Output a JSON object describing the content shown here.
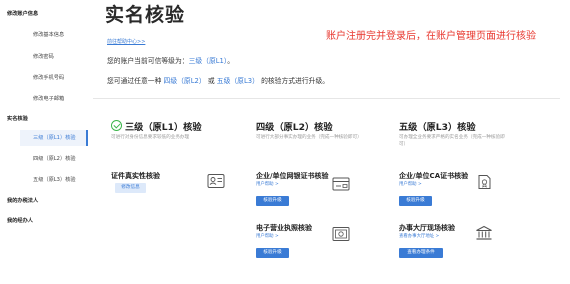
{
  "sidebar": {
    "groups": [
      {
        "label": "修改账户信息"
      },
      {
        "label": "实名核验"
      },
      {
        "label": "我的办税法人"
      },
      {
        "label": "我的经办人"
      }
    ],
    "items": [
      {
        "label": "修改基本信息"
      },
      {
        "label": "修改密码"
      },
      {
        "label": "修改手机号码"
      },
      {
        "label": "修改电子邮箱"
      },
      {
        "label": "三级（原L1）核验"
      },
      {
        "label": "四级（原L2）核验"
      },
      {
        "label": "五级（原L3）核验"
      }
    ]
  },
  "header": {
    "title": "实名核验",
    "annotation": "账户注册完并登录后，在账户管理页面进行核验",
    "help_link": "前往帮助中心>>",
    "line1_prefix": "您的账户当前可信等级为：",
    "line1_level": "三级（原L1）",
    "line1_suffix": "。",
    "line2_prefix": "您可通过任意一种",
    "line2_l2": "四级（原L2）",
    "line2_or": "或",
    "line2_l3": "五级（原L3）",
    "line2_suffix": "的核验方式进行升级。"
  },
  "cards": {
    "l1": {
      "title": "三级（原L1）核验",
      "desc": "可进行对身份信息要求较低的业务办理",
      "item_title": "证件真实性核验",
      "item_button": "修改信息"
    },
    "l2": {
      "title": "四级（原L2）核验",
      "desc": "可进行大部分事实办理的业务（完成一种核验即可）",
      "item1_title": "企业/单位网银证书核验",
      "item1_sub": "用户帮助 >",
      "item1_button": "核验升级",
      "item2_title": "电子营业执照核验",
      "item2_sub": "用户帮助 >",
      "item2_button": "核验升级"
    },
    "l3": {
      "title": "五级（原L3）核验",
      "desc": "可办理全业务要求严格的实名业务（完成一种核验即可）",
      "item1_title": "企业/单位CA证书核验",
      "item1_sub": "用户帮助 >",
      "item1_button": "核验升级",
      "item2_title": "办事大厅现场核验",
      "item2_sub": "查看办事大厅地址 >",
      "item2_button": "查看办理条件"
    }
  },
  "colors": {
    "accent": "#3a7bd5",
    "annotation": "#e8382f",
    "success": "#3bb54a"
  }
}
